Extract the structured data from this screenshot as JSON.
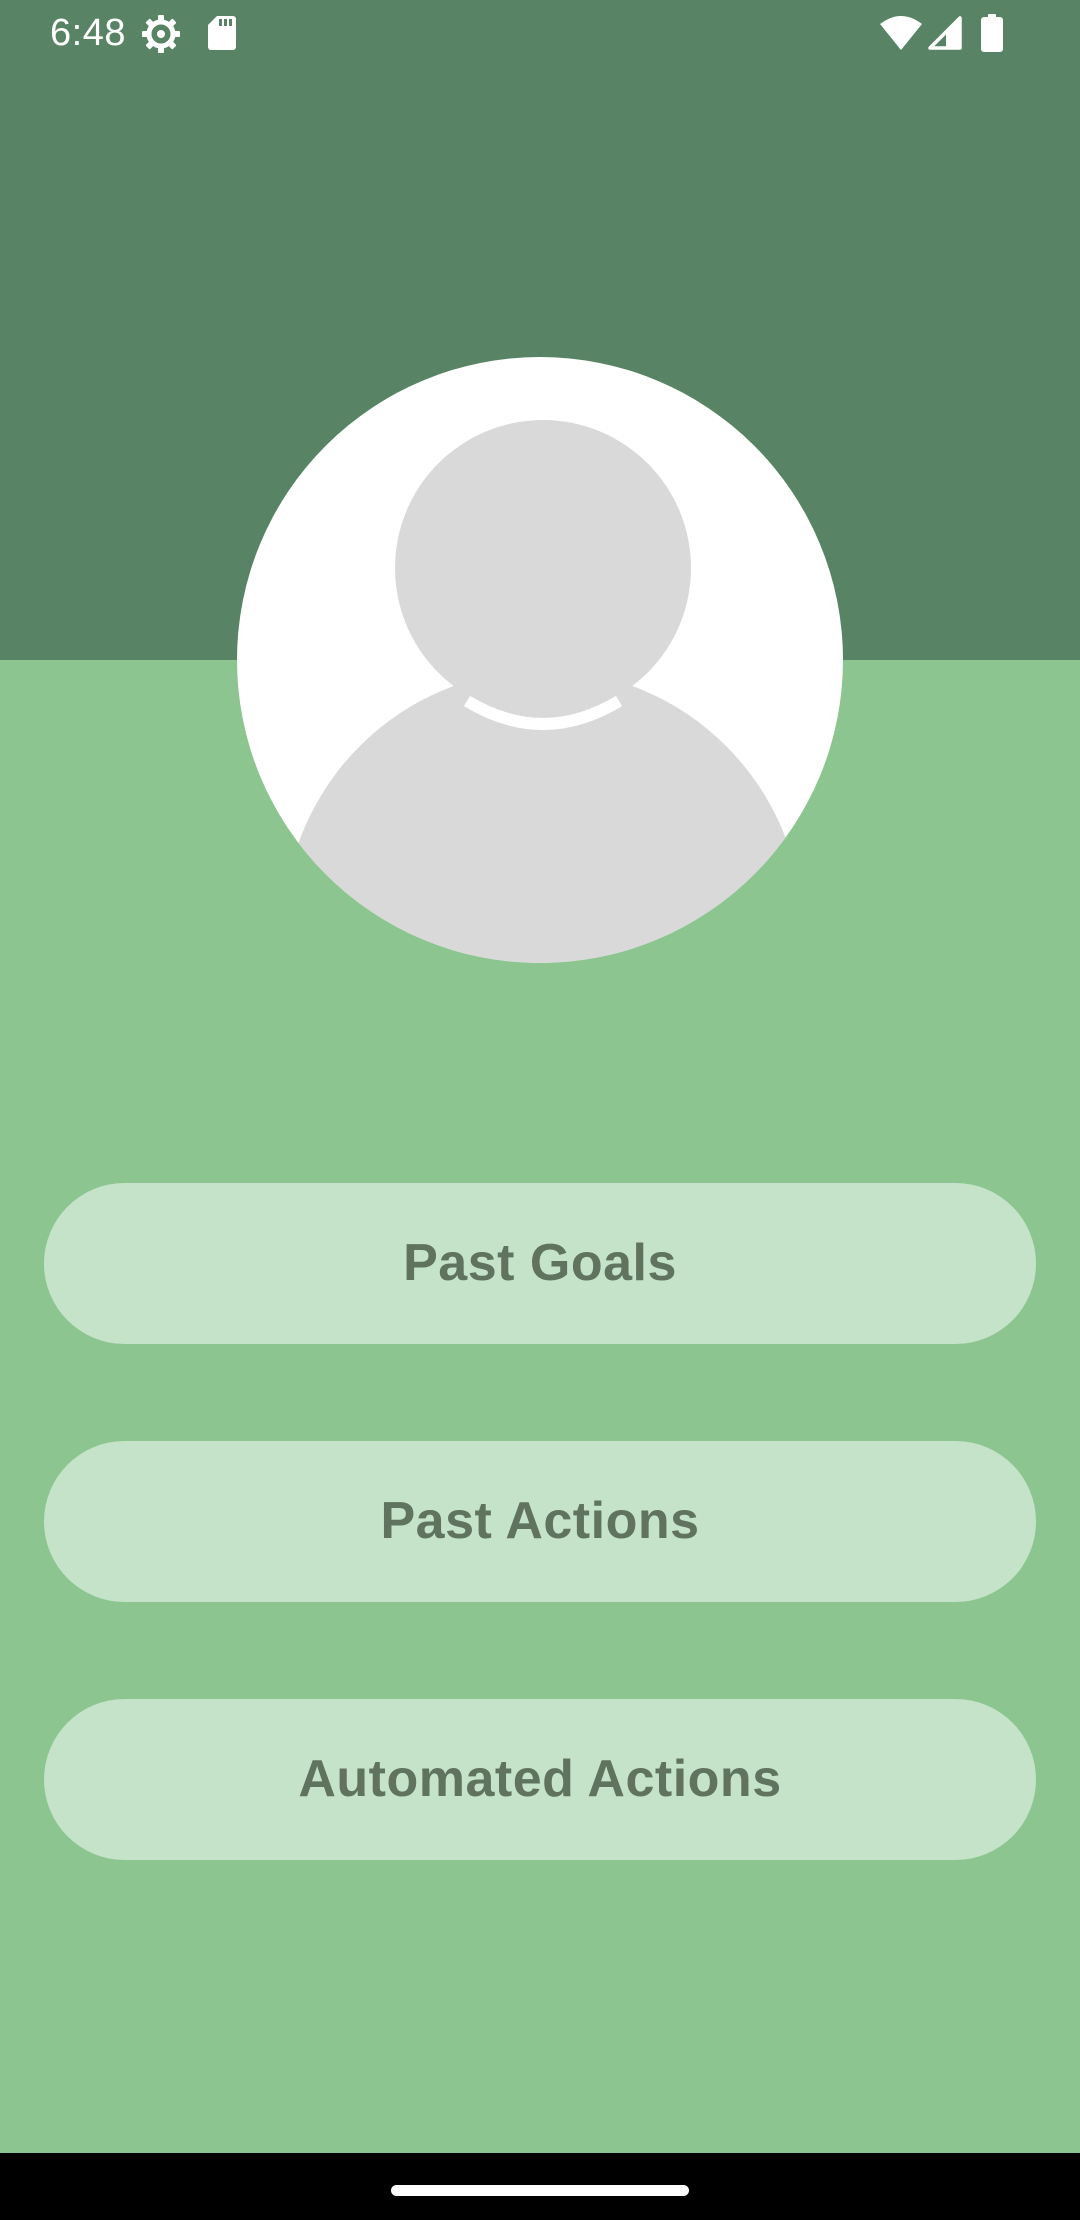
{
  "status_bar": {
    "time": "6:48",
    "left_icons": [
      "settings-icon",
      "sd-card-icon"
    ],
    "right_icons": [
      "wifi-icon",
      "cell-signal-icon",
      "battery-icon"
    ]
  },
  "profile": {
    "avatar": "default-person-avatar"
  },
  "buttons": {
    "past_goals": "Past Goals",
    "past_actions": "Past Actions",
    "automated_actions": "Automated Actions"
  },
  "colors": {
    "header": "#588465",
    "background": "#8cc58f",
    "button_fill": "#c4e3c9",
    "button_text": "#5f735f",
    "avatar_placeholder": "#d9d9d9"
  }
}
